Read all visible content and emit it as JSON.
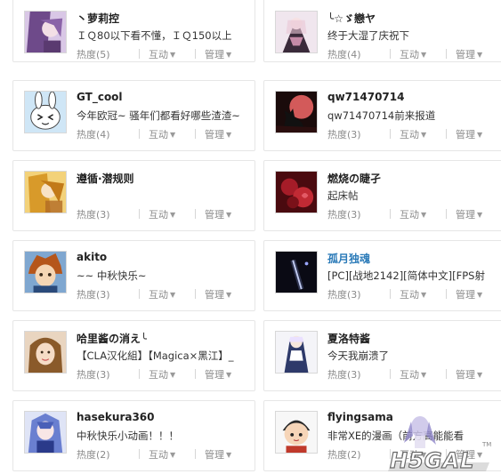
{
  "cards": [
    {
      "name": "丶萝莉控",
      "message": "ＩＱ80以下看不懂，ＩＱ150以上",
      "heat": "热度(5)",
      "interact": "互动",
      "manage": "管理",
      "avatar": "anime-purple-avatar"
    },
    {
      "name": "╰☆ゞ戀ヤ",
      "message": "终于大湿了庆祝下",
      "heat": "热度(4)",
      "interact": "互动",
      "manage": "管理",
      "avatar": "anime-gothic-avatar"
    },
    {
      "name": "GT_cool",
      "message": "今年欧冠~ 骚年们都看好哪些渣渣~",
      "heat": "热度(4)",
      "interact": "互动",
      "manage": "管理",
      "avatar": "bunny-face-avatar"
    },
    {
      "name": "qw71470714",
      "message": "qw71470714前来报道",
      "heat": "热度(3)",
      "interact": "互动",
      "manage": "管理",
      "avatar": "wolf-moon-avatar"
    },
    {
      "name": "遵循·潜规则",
      "message": "",
      "heat": "热度(3)",
      "interact": "互动",
      "manage": "管理",
      "avatar": "anime-gold-avatar"
    },
    {
      "name": "燃烧の睫孑",
      "message": "起床帖",
      "heat": "热度(3)",
      "interact": "互动",
      "manage": "管理",
      "avatar": "red-rose-avatar"
    },
    {
      "name": "akito",
      "message": "~~ 中秋快乐~",
      "heat": "热度(3)",
      "interact": "互动",
      "manage": "管理",
      "avatar": "anime-boy-avatar"
    },
    {
      "name": "孤月独魂",
      "message": "[PC][战地2142][简体中文][FPS射",
      "heat": "热度(3)",
      "interact": "互动",
      "manage": "管理",
      "avatar": "dark-light-avatar",
      "link": true
    },
    {
      "name": "哈里酱の消え╰",
      "message": "【CLA汉化組】【Magica×黑江】_",
      "heat": "热度(3)",
      "interact": "互动",
      "manage": "管理",
      "avatar": "girl-portrait-avatar"
    },
    {
      "name": "夏洛特酱",
      "message": "今天我崩溃了",
      "heat": "热度(3)",
      "interact": "互动",
      "manage": "管理",
      "avatar": "maid-figure-avatar"
    },
    {
      "name": "hasekura360",
      "message": "中秋快乐小动画！！！",
      "heat": "热度(2)",
      "interact": "互动",
      "manage": "管理",
      "avatar": "anime-blue-hair-avatar"
    },
    {
      "name": "flyingsama",
      "message": "非常XE的漫画（前方高能能看",
      "heat": "热度(2)",
      "interact": "互动",
      "manage": "管理",
      "avatar": "cartoon-boy-avatar"
    }
  ],
  "watermark": {
    "text": "H5GAL",
    "tm": "TM"
  }
}
